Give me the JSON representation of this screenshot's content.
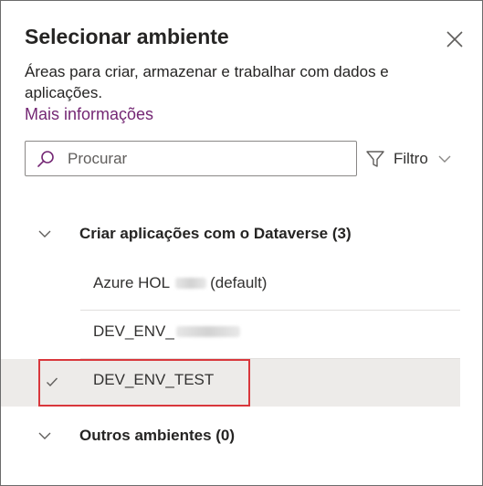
{
  "panel": {
    "title": "Selecionar ambiente",
    "description": "Áreas para criar, armazenar e trabalhar com dados e aplicações.",
    "more_info_link": "Mais informações",
    "accent_color": "#742774",
    "close_icon": "close-icon"
  },
  "search": {
    "placeholder": "Procurar",
    "value": "",
    "icon": "search-icon"
  },
  "filter": {
    "label": "Filtro",
    "icon": "filter-icon"
  },
  "groups": [
    {
      "label": "Criar aplicações com o Dataverse (3)",
      "expanded": true,
      "items": [
        {
          "prefix": "Azure HOL",
          "suffix": "(default)",
          "selected": false,
          "redacted": true
        },
        {
          "prefix": "DEV_ENV_",
          "suffix": "",
          "selected": false,
          "redacted": true
        },
        {
          "prefix": "DEV_ENV_TEST",
          "suffix": "",
          "selected": true,
          "redacted": false
        }
      ]
    },
    {
      "label": "Outros ambientes (0)",
      "expanded": true,
      "items": []
    }
  ],
  "highlight_color": "#d9373c"
}
